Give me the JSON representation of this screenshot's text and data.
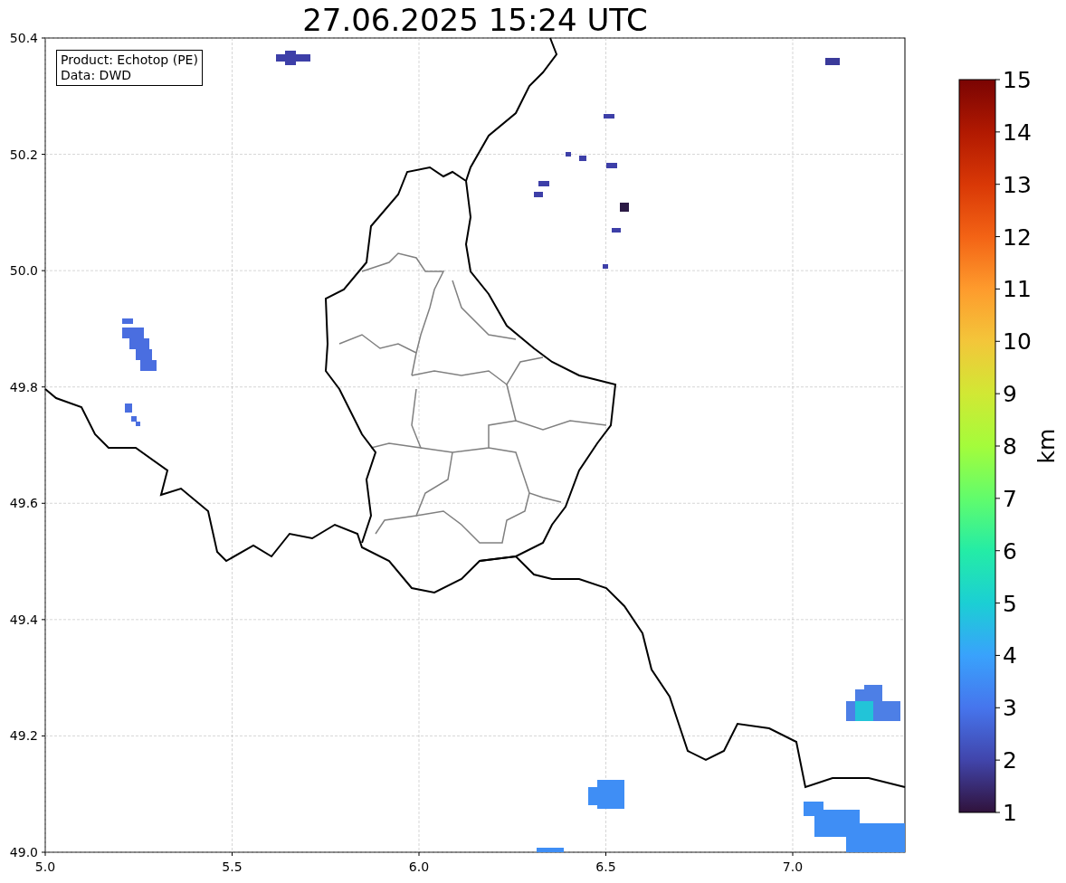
{
  "title": "27.06.2025 15:24 UTC",
  "annotation": [
    "Product: Echotop (PE)",
    "Data: DWD"
  ],
  "map": {
    "xticks": [
      "5.0",
      "5.5",
      "6.0",
      "6.5",
      "7.0"
    ],
    "yticks": [
      "50.4",
      "50.2",
      "50.0",
      "49.8",
      "49.6",
      "49.4",
      "49.2",
      "49.0"
    ]
  },
  "colorbar": {
    "label": "km",
    "ticks": [
      "15",
      "14",
      "13",
      "12",
      "11",
      "10",
      "9",
      "8",
      "7",
      "6",
      "5",
      "4",
      "3",
      "2",
      "1"
    ]
  }
}
